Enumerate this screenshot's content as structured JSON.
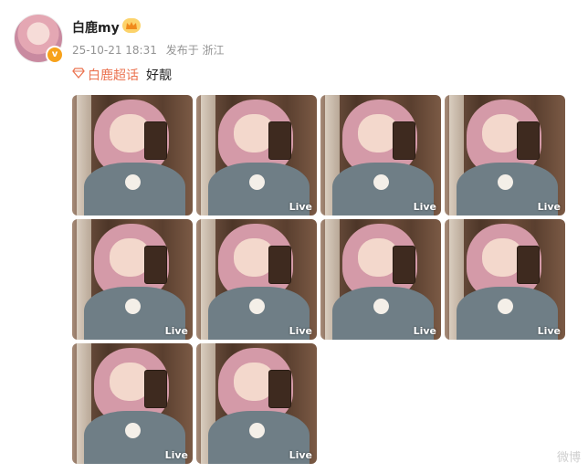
{
  "post": {
    "username": "白鹿my",
    "timestamp": "25-10-21 18:31",
    "source": "发布于 浙江",
    "topic": "白鹿超话",
    "text": "好靓",
    "verified_badge": "v"
  },
  "photos": [
    {
      "live": ""
    },
    {
      "live": "Live"
    },
    {
      "live": "Live"
    },
    {
      "live": "Live"
    },
    {
      "live": "Live"
    },
    {
      "live": "Live"
    },
    {
      "live": "Live"
    },
    {
      "live": "Live"
    },
    {
      "live": "Live"
    },
    {
      "live": "Live"
    }
  ],
  "watermark": "微博",
  "colors": {
    "topic": "#eb7350",
    "meta": "#939393",
    "badge": "#f7a21b"
  }
}
